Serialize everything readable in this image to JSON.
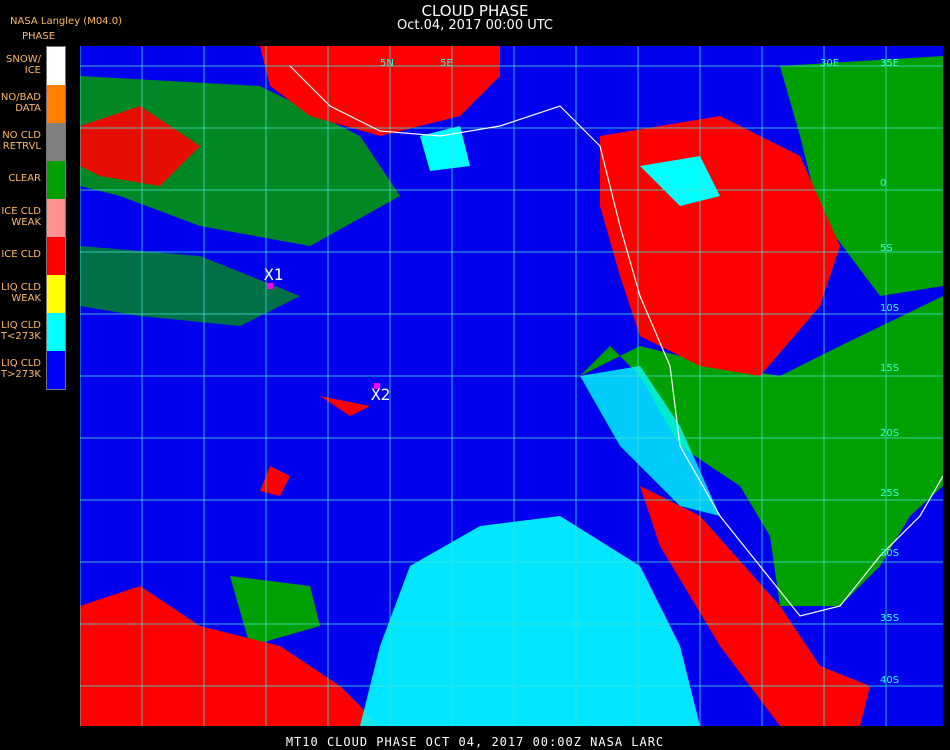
{
  "header": {
    "title": "CLOUD PHASE",
    "subtitle": "Oct.04, 2017 00:00 UTC",
    "source": "NASA Langley (M04.0)",
    "legend_title": "PHASE"
  },
  "legend": [
    {
      "label": "SNOW/\nICE",
      "color": "#ffffff"
    },
    {
      "label": "NO/BAD\nDATA",
      "color": "#ff8000"
    },
    {
      "label": "NO CLD\nRETRVL",
      "color": "#808080"
    },
    {
      "label": "CLEAR",
      "color": "#00a000"
    },
    {
      "label": "ICE CLD\nWEAK",
      "color": "#ff9090"
    },
    {
      "label": "ICE CLD",
      "color": "#ff0000"
    },
    {
      "label": "LIQ CLD\nWEAK",
      "color": "#ffff00"
    },
    {
      "label": "LIQ CLD\nT<273K",
      "color": "#00ffff"
    },
    {
      "label": "LIQ CLD\nT>273K",
      "color": "#0000ff"
    }
  ],
  "markers": [
    {
      "label": "X1"
    },
    {
      "label": "X2"
    }
  ],
  "grid_labels": [
    "5N",
    "5E",
    "0",
    "5S",
    "10S",
    "15S",
    "20S",
    "25S",
    "30S",
    "35S",
    "40S",
    "30E",
    "35E"
  ],
  "colors": {
    "liquid_warm": "#0000ee",
    "liquid_cold": "#00ffff",
    "ice": "#ff0000",
    "clear": "#00a000",
    "grid": "#40e0d0",
    "coast": "#ffffff",
    "marker": "#ff00ff"
  },
  "footer": "MT10  CLOUD PHASE   OCT 04, 2017 00:00Z   NASA LARC"
}
